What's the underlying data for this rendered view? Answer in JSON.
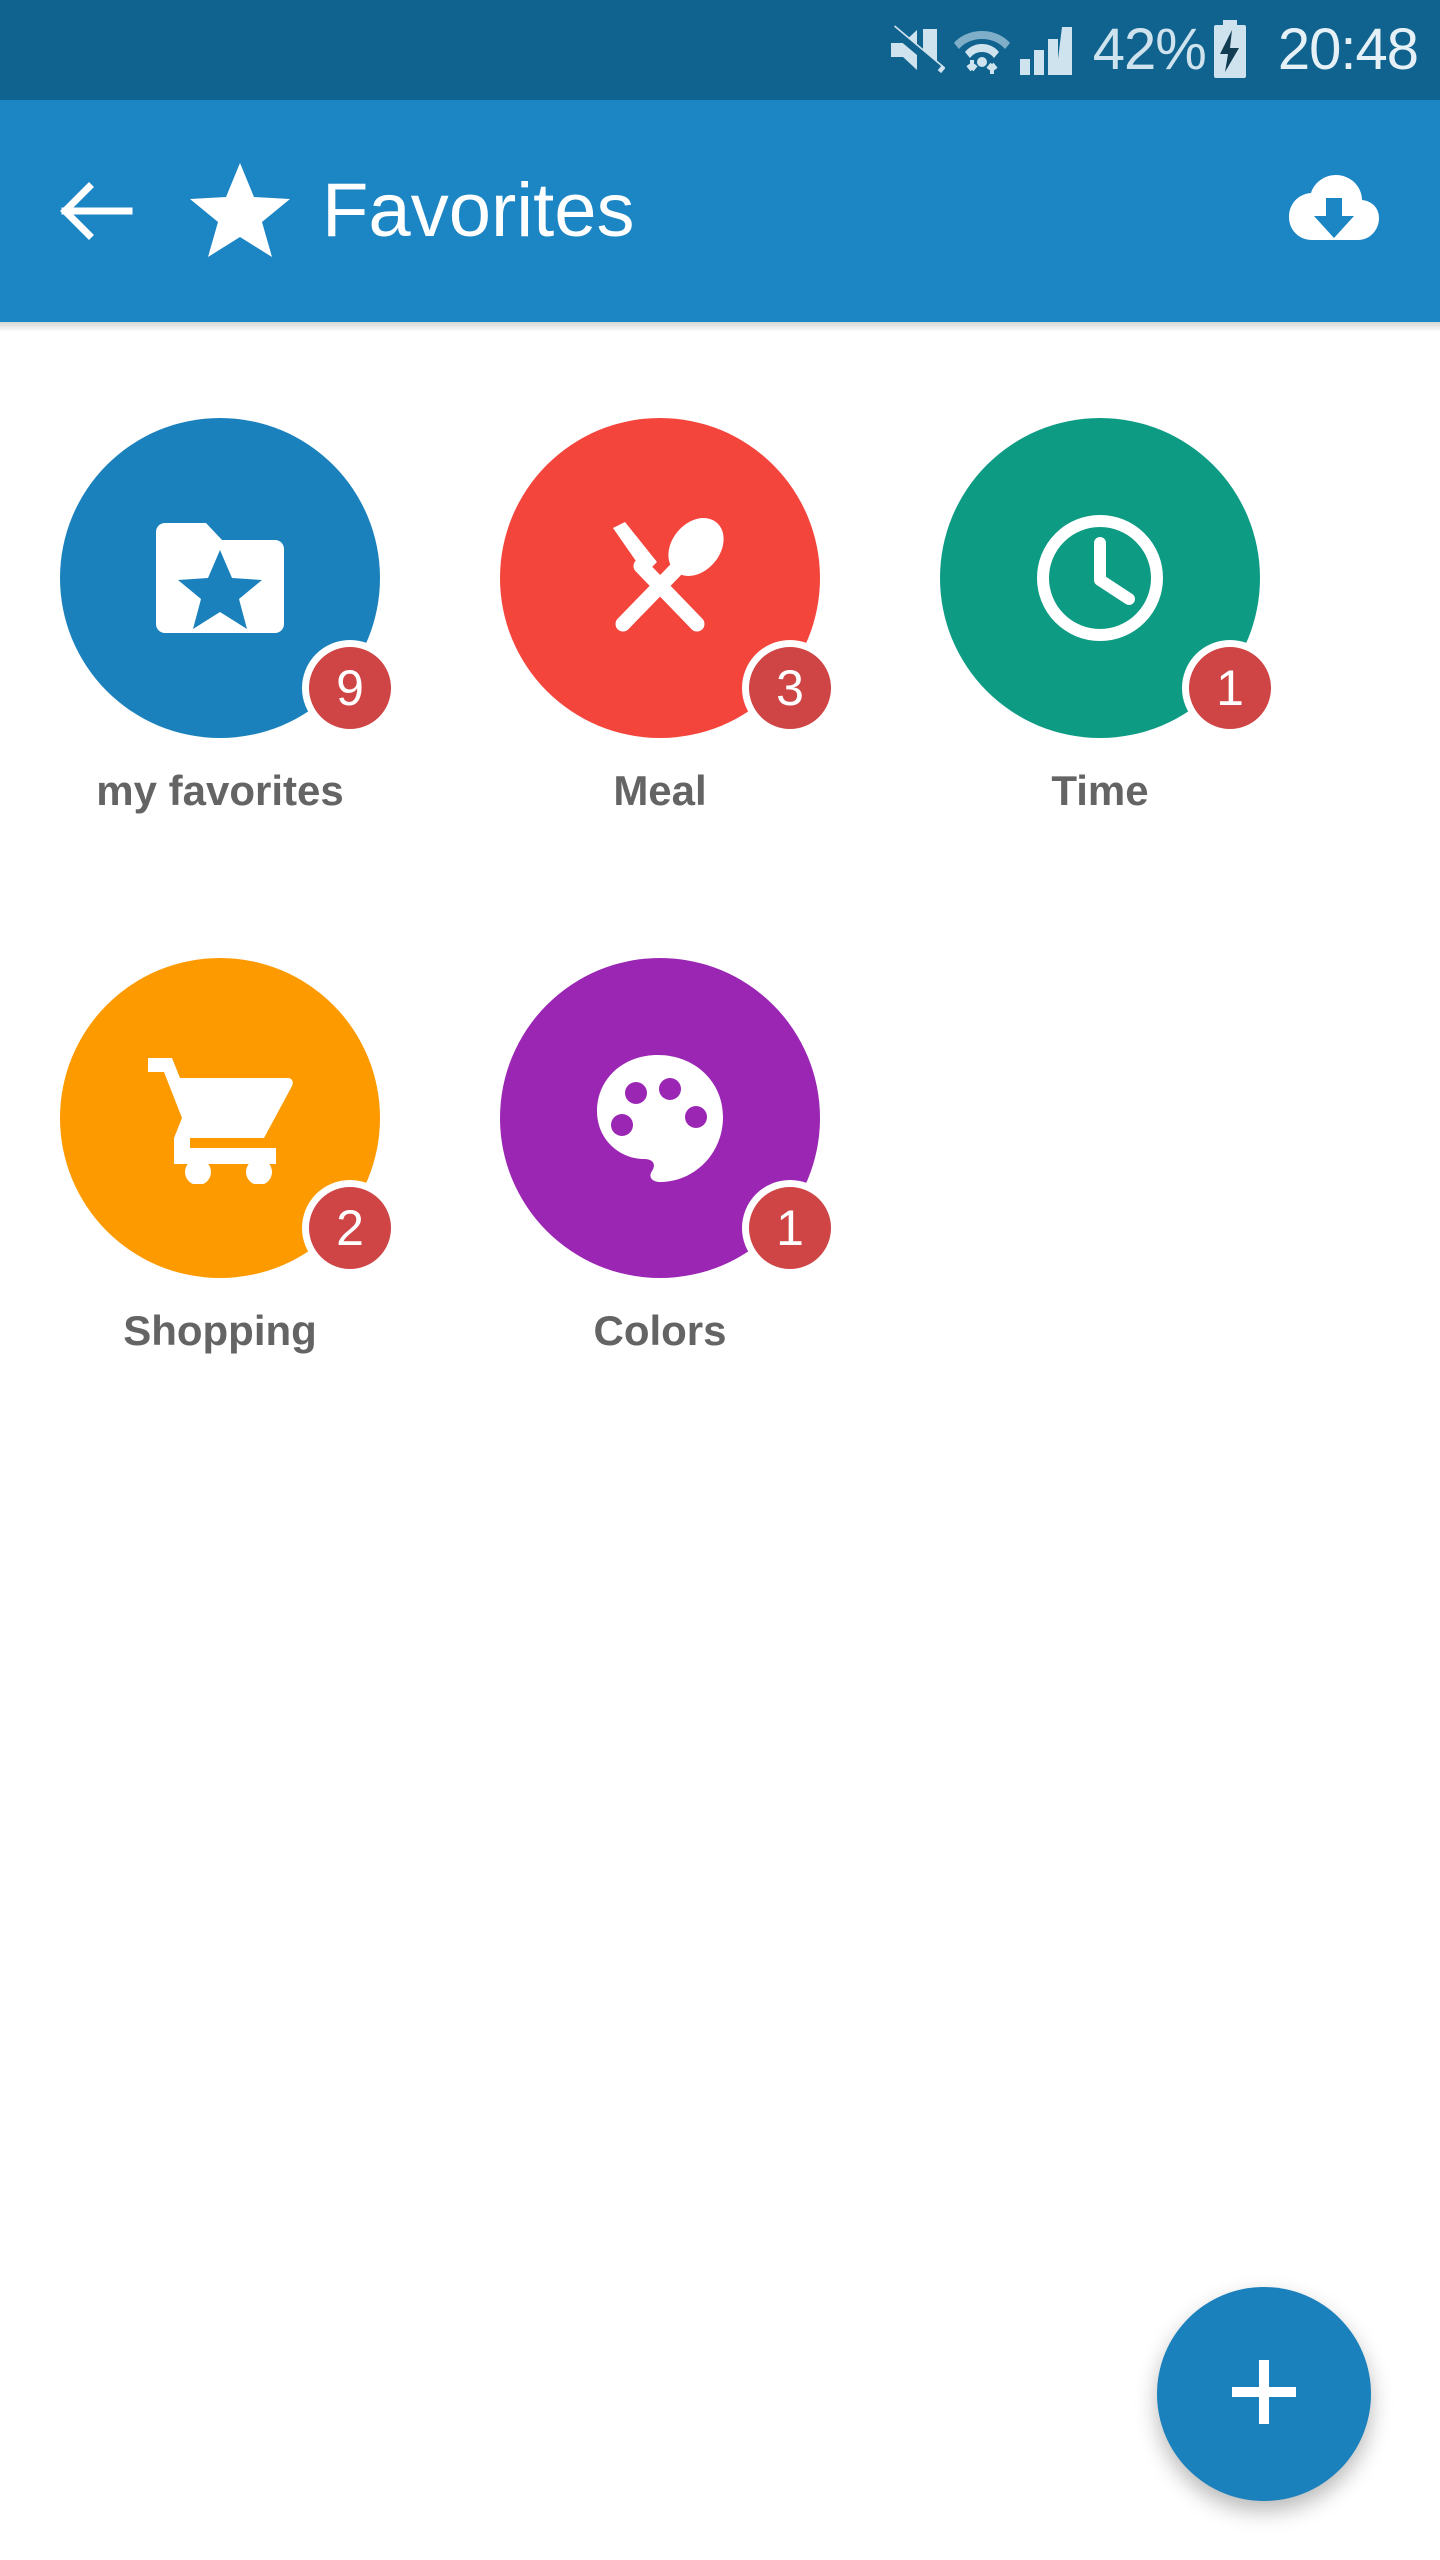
{
  "status_bar": {
    "background": "#10638E",
    "icons": [
      "mute-icon",
      "wifi-icon",
      "signal-icon",
      "battery-charging-icon"
    ],
    "battery_percent": "42%",
    "time": "20:48"
  },
  "app_bar": {
    "background": "#1C85C4",
    "back_icon": "arrow-left-icon",
    "brand_icon": "star-icon",
    "title": "Favorites",
    "action_icon": "cloud-download-icon"
  },
  "grid": {
    "items": [
      {
        "label": "my favorites",
        "badge": "9",
        "color": "#1B81BC",
        "icon": "folder-star-icon"
      },
      {
        "label": "Meal",
        "badge": "3",
        "color": "#F4453C",
        "icon": "cutlery-icon"
      },
      {
        "label": "Time",
        "badge": "1",
        "color": "#0D9B84",
        "icon": "clock-icon"
      },
      {
        "label": "Shopping",
        "badge": "2",
        "color": "#FD9A00",
        "icon": "shopping-cart-icon"
      },
      {
        "label": "Colors",
        "badge": "1",
        "color": "#9A26B3",
        "icon": "palette-icon"
      }
    ],
    "badge_color": "#CF4545",
    "label_color": "#646464"
  },
  "fab": {
    "icon": "plus-icon",
    "color": "#1B81BC"
  }
}
